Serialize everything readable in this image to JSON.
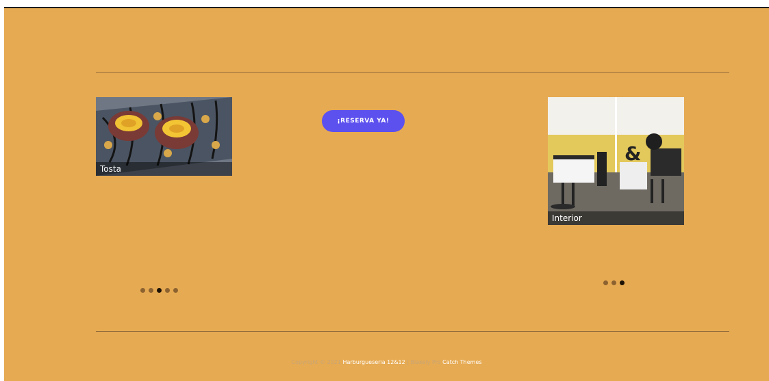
{
  "widgets": {
    "left": {
      "caption": "Tosta",
      "dots": [
        false,
        false,
        true,
        false,
        false
      ]
    },
    "right": {
      "caption": "Interior",
      "dots": [
        false,
        false,
        true
      ]
    }
  },
  "reserve_button": {
    "label": "¡RESERVA YA!"
  },
  "footer": {
    "copyright": "Copyright © 2021",
    "site_name": "Harburgueseria 12&12",
    "separator": "|",
    "credit_prefix": "Blakely Pro",
    "theme_author": "Catch Themes"
  }
}
